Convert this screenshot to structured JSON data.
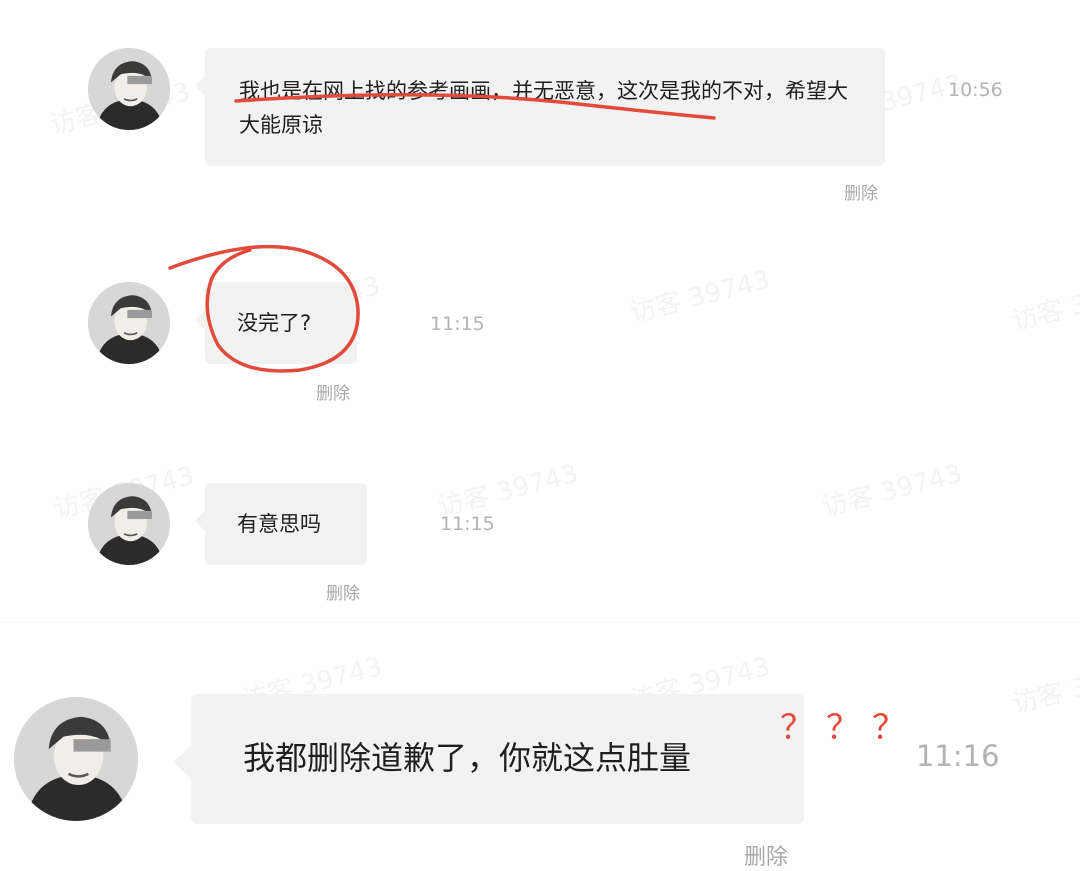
{
  "watermark_text": "访客 39743",
  "messages": [
    {
      "text": "我也是在网上找的参考画画，并无恶意，这次是我的不对，希望大大能原谅",
      "time": "10:56",
      "delete_label": "删除"
    },
    {
      "text": "没完了?",
      "time": "11:15",
      "delete_label": "删除"
    },
    {
      "text": "有意思吗",
      "time": "11:15",
      "delete_label": "删除"
    },
    {
      "text": "我都删除道歉了，你就这点肚量",
      "time": "11:16",
      "delete_label": "删除"
    }
  ],
  "annotation": {
    "question_marks": "？？？",
    "color": "#e24a3b"
  },
  "colors": {
    "bubble": "#f2f2f2",
    "time_text": "#b3b3b3",
    "delete_text": "#a8a8a8",
    "annotation_red": "#e24a3b"
  }
}
